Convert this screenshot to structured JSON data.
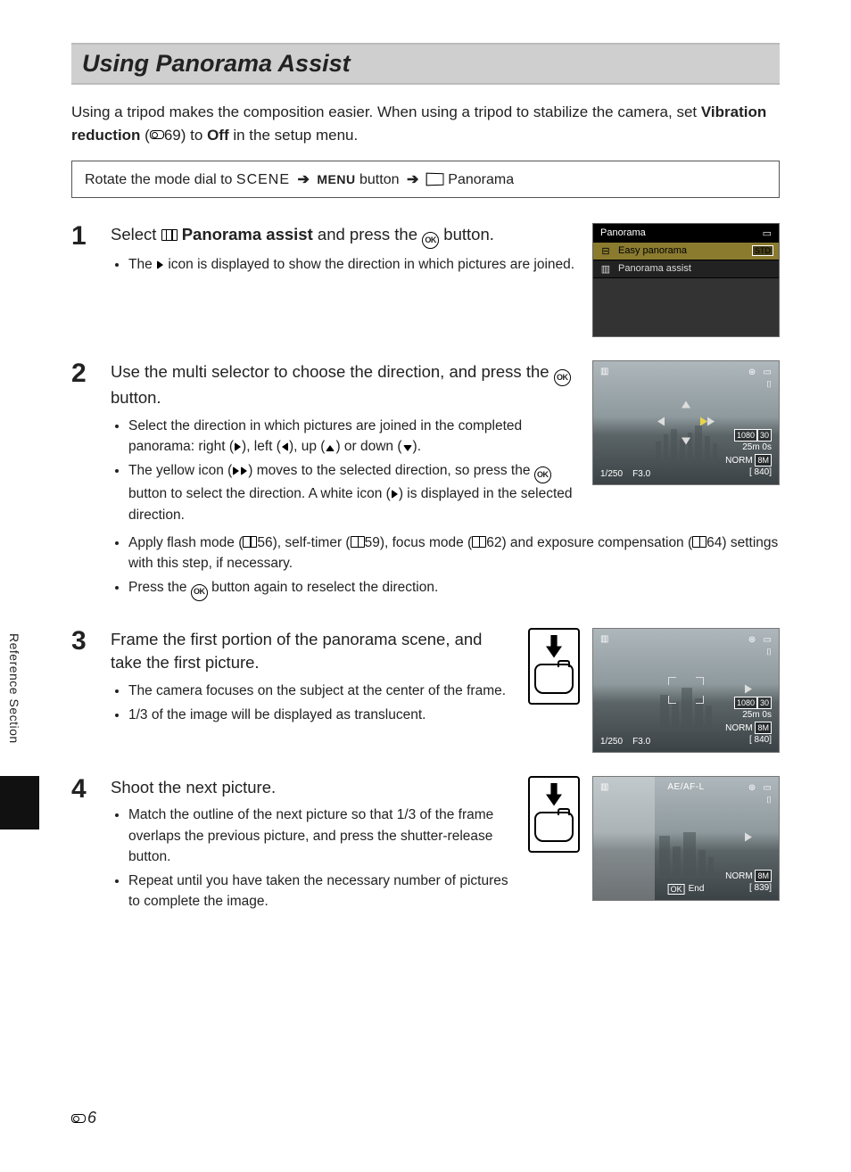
{
  "sideTab": "Reference Section",
  "title": "Using Panorama Assist",
  "intro": {
    "pre": "Using a tripod makes the composition easier. When using a tripod to stabilize the camera, set ",
    "bold1": "Vibration reduction",
    "mid": " (",
    "ref": "69",
    "mid2": ") to ",
    "bold2": "Off",
    "post": " in the setup menu."
  },
  "navBox": {
    "pre": "Rotate the mode dial to ",
    "scene": "SCENE",
    "menu": "MENU",
    "menuBtn": " button",
    "pano": " Panorama"
  },
  "steps": {
    "s1": {
      "num": "1",
      "headA": "Select ",
      "headBold": " Panorama assist",
      "headB": " and press the ",
      "headC": " button.",
      "b1a": "The ",
      "b1b": " icon is displayed to show the direction in which pictures are joined."
    },
    "s2": {
      "num": "2",
      "head": "Use the multi selector to choose the direction, and press the ",
      "headEnd": " button.",
      "b1a": "Select the direction in which pictures are joined in the completed panorama: right (",
      "b1b": "), left (",
      "b1c": "), up (",
      "b1d": ") or down (",
      "b1e": ").",
      "b2a": "The yellow icon (",
      "b2b": ") moves to the selected direction, so press the ",
      "b2c": " button to select the direction. A white icon (",
      "b2d": ") is displayed in the selected direction.",
      "b3a": "Apply flash mode (",
      "b3ref1": "56",
      "b3b": "), self-timer (",
      "b3ref2": "59",
      "b3c": "), focus mode (",
      "b3ref3": "62",
      "b3d": ") and exposure compensation (",
      "b3ref4": "64",
      "b3e": ") settings with this step, if necessary.",
      "b4a": "Press the ",
      "b4b": " button again to reselect the direction."
    },
    "s3": {
      "num": "3",
      "head": "Frame the first portion of the panorama scene, and take the first picture.",
      "b1": "The camera focuses on the subject at the center of the frame.",
      "b2": "1/3 of the image will be displayed as translucent."
    },
    "s4": {
      "num": "4",
      "head": "Shoot the next picture.",
      "b1": "Match the outline of the next picture so that 1/3 of the frame overlaps the previous picture, and press the shutter-release button.",
      "b2": "Repeat until you have taken the necessary number of pictures to complete the image."
    }
  },
  "lcdMenu": {
    "title": "Panorama",
    "row1": "Easy panorama",
    "row1badge": "STD",
    "row2": "Panorama assist"
  },
  "lcdInfo": {
    "shutter": "1/250",
    "aperture": "F3.0",
    "res": "1080",
    "time": "25m 0s",
    "norm": "NORM",
    "remain": "[  840]",
    "remain2": "[  839]",
    "aeafl": "AE/AF-L",
    "okEnd": "End",
    "flash": "⊛",
    "batt": "▭",
    "card": "⌷"
  },
  "footer": {
    "pageNum": "6"
  }
}
